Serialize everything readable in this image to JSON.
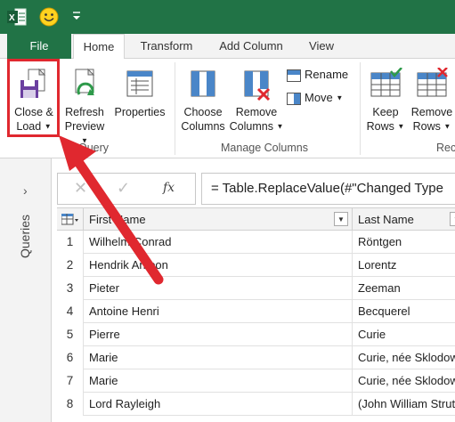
{
  "quick_access": {
    "app_icon": "excel-icon",
    "smiley_icon": "smiley-icon",
    "customize_icon": "chevron-down-icon"
  },
  "tabs": [
    {
      "label": "File"
    },
    {
      "label": "Home"
    },
    {
      "label": "Transform"
    },
    {
      "label": "Add Column"
    },
    {
      "label": "View"
    }
  ],
  "ribbon": {
    "close_load": {
      "line1": "Close &",
      "line2": "Load"
    },
    "refresh_preview": {
      "line1": "Refresh",
      "line2": "Preview"
    },
    "properties": {
      "line1": "Properties"
    },
    "choose_columns": {
      "line1": "Choose",
      "line2": "Columns"
    },
    "remove_columns": {
      "line1": "Remove",
      "line2": "Columns"
    },
    "rename": {
      "label": "Rename"
    },
    "move": {
      "label": "Move"
    },
    "keep_rows": {
      "line1": "Keep",
      "line2": "Rows"
    },
    "remove_rows": {
      "line1": "Remove",
      "line2": "Rows"
    },
    "groups": {
      "query": "Query",
      "manage_columns": "Manage Columns",
      "reduce": "Rec"
    }
  },
  "side_pane": {
    "label": "Queries"
  },
  "formula_bar": {
    "fx_label": "fx",
    "formula": "= Table.ReplaceValue(#\"Changed Type"
  },
  "table": {
    "columns": [
      "First Name",
      "Last Name"
    ],
    "rows": [
      {
        "n": "1",
        "first": "Wilhelm Conrad",
        "last": "Röntgen"
      },
      {
        "n": "2",
        "first": "Hendrik Antoon",
        "last": "Lorentz"
      },
      {
        "n": "3",
        "first": "Pieter",
        "last": "Zeeman"
      },
      {
        "n": "4",
        "first": "Antoine Henri",
        "last": "Becquerel"
      },
      {
        "n": "5",
        "first": "Pierre",
        "last": "Curie"
      },
      {
        "n": "6",
        "first": "Marie",
        "last": "Curie, née Sklodowska"
      },
      {
        "n": "7",
        "first": "Marie",
        "last": "Curie, née Sklodowska"
      },
      {
        "n": "8",
        "first": "Lord Rayleigh",
        "last": "(John William Strutt)"
      }
    ]
  },
  "colors": {
    "excel_green": "#217346",
    "highlight_red": "#e0282f"
  }
}
